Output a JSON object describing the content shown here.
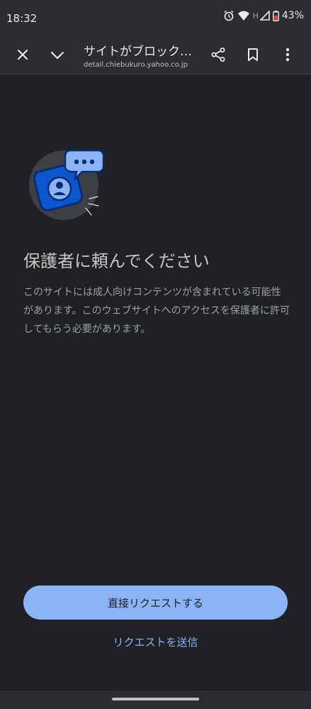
{
  "status_bar": {
    "time": "18:32",
    "network_label": "H",
    "battery": "43%"
  },
  "toolbar": {
    "title": "サイトがブロック…",
    "url": "detail.chiebukuro.yahoo.co.jp",
    "icons": [
      "close-icon",
      "chevron-down-icon",
      "share-icon",
      "bookmark-icon",
      "more-vert-icon"
    ]
  },
  "illustration": {
    "icons": [
      "person-badge-icon",
      "chat-bubble-icon"
    ],
    "colors": {
      "circle": "#3c4043",
      "badge": "#1a73e8",
      "bubble": "#8ab4f8"
    }
  },
  "main": {
    "heading": "保護者に頼んでください",
    "description": "このサイトには成人向けコンテンツが含まれている可能性があります。このウェブサイトへのアクセスを保護者に許可してもらう必要があります。"
  },
  "actions": {
    "primary_label": "直接リクエストする",
    "secondary_label": "リクエストを送信"
  },
  "colors": {
    "background": "#202124",
    "accent": "#8ab4f8"
  }
}
